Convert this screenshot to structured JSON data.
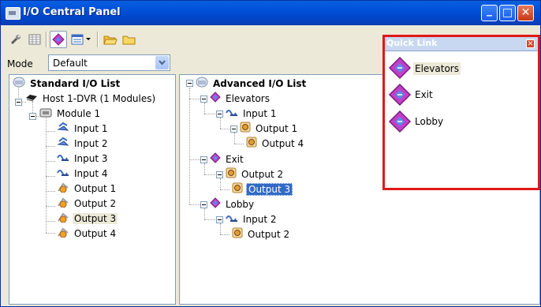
{
  "window": {
    "title": "I/O Central Panel",
    "minimize_label": "_",
    "maximize_label": "□",
    "close_label": "✕"
  },
  "toolbar": {
    "buttons": [
      "wrench-icon",
      "grid-icon",
      "io-icon",
      "list-icon",
      "dropdown-arrow-icon",
      "open-folder-icon",
      "folder-icon"
    ]
  },
  "mode": {
    "label": "Mode",
    "value": "Default"
  },
  "standard_tree": {
    "root": "Standard I/O List",
    "host": "Host 1-DVR (1 Modules)",
    "module": "Module 1",
    "items": [
      "Input 1",
      "Input 2",
      "Input 3",
      "Input 4",
      "Output 1",
      "Output 2",
      "Output 3",
      "Output 4"
    ]
  },
  "advanced_tree": {
    "root": "Advanced I/O List",
    "groups": [
      {
        "label": "Elevators",
        "children": [
          {
            "label": "Input 1"
          },
          {
            "label": "Output 1"
          },
          {
            "label": "Output 4"
          }
        ]
      },
      {
        "label": "Exit",
        "children": [
          {
            "label": "Output 2"
          },
          {
            "label": "Output 3"
          }
        ]
      },
      {
        "label": "Lobby",
        "children": [
          {
            "label": "Input 2"
          },
          {
            "label": "Output 2"
          }
        ]
      }
    ]
  },
  "quick_link": {
    "title": "Quick Link",
    "close_label": "✕",
    "items": [
      "Elevators",
      "Exit",
      "Lobby"
    ]
  },
  "colors": {
    "titlebar": "#0050d8",
    "selection": "#316ac5",
    "highlight_border": "#e01818",
    "group_icon": "#c040c8"
  }
}
